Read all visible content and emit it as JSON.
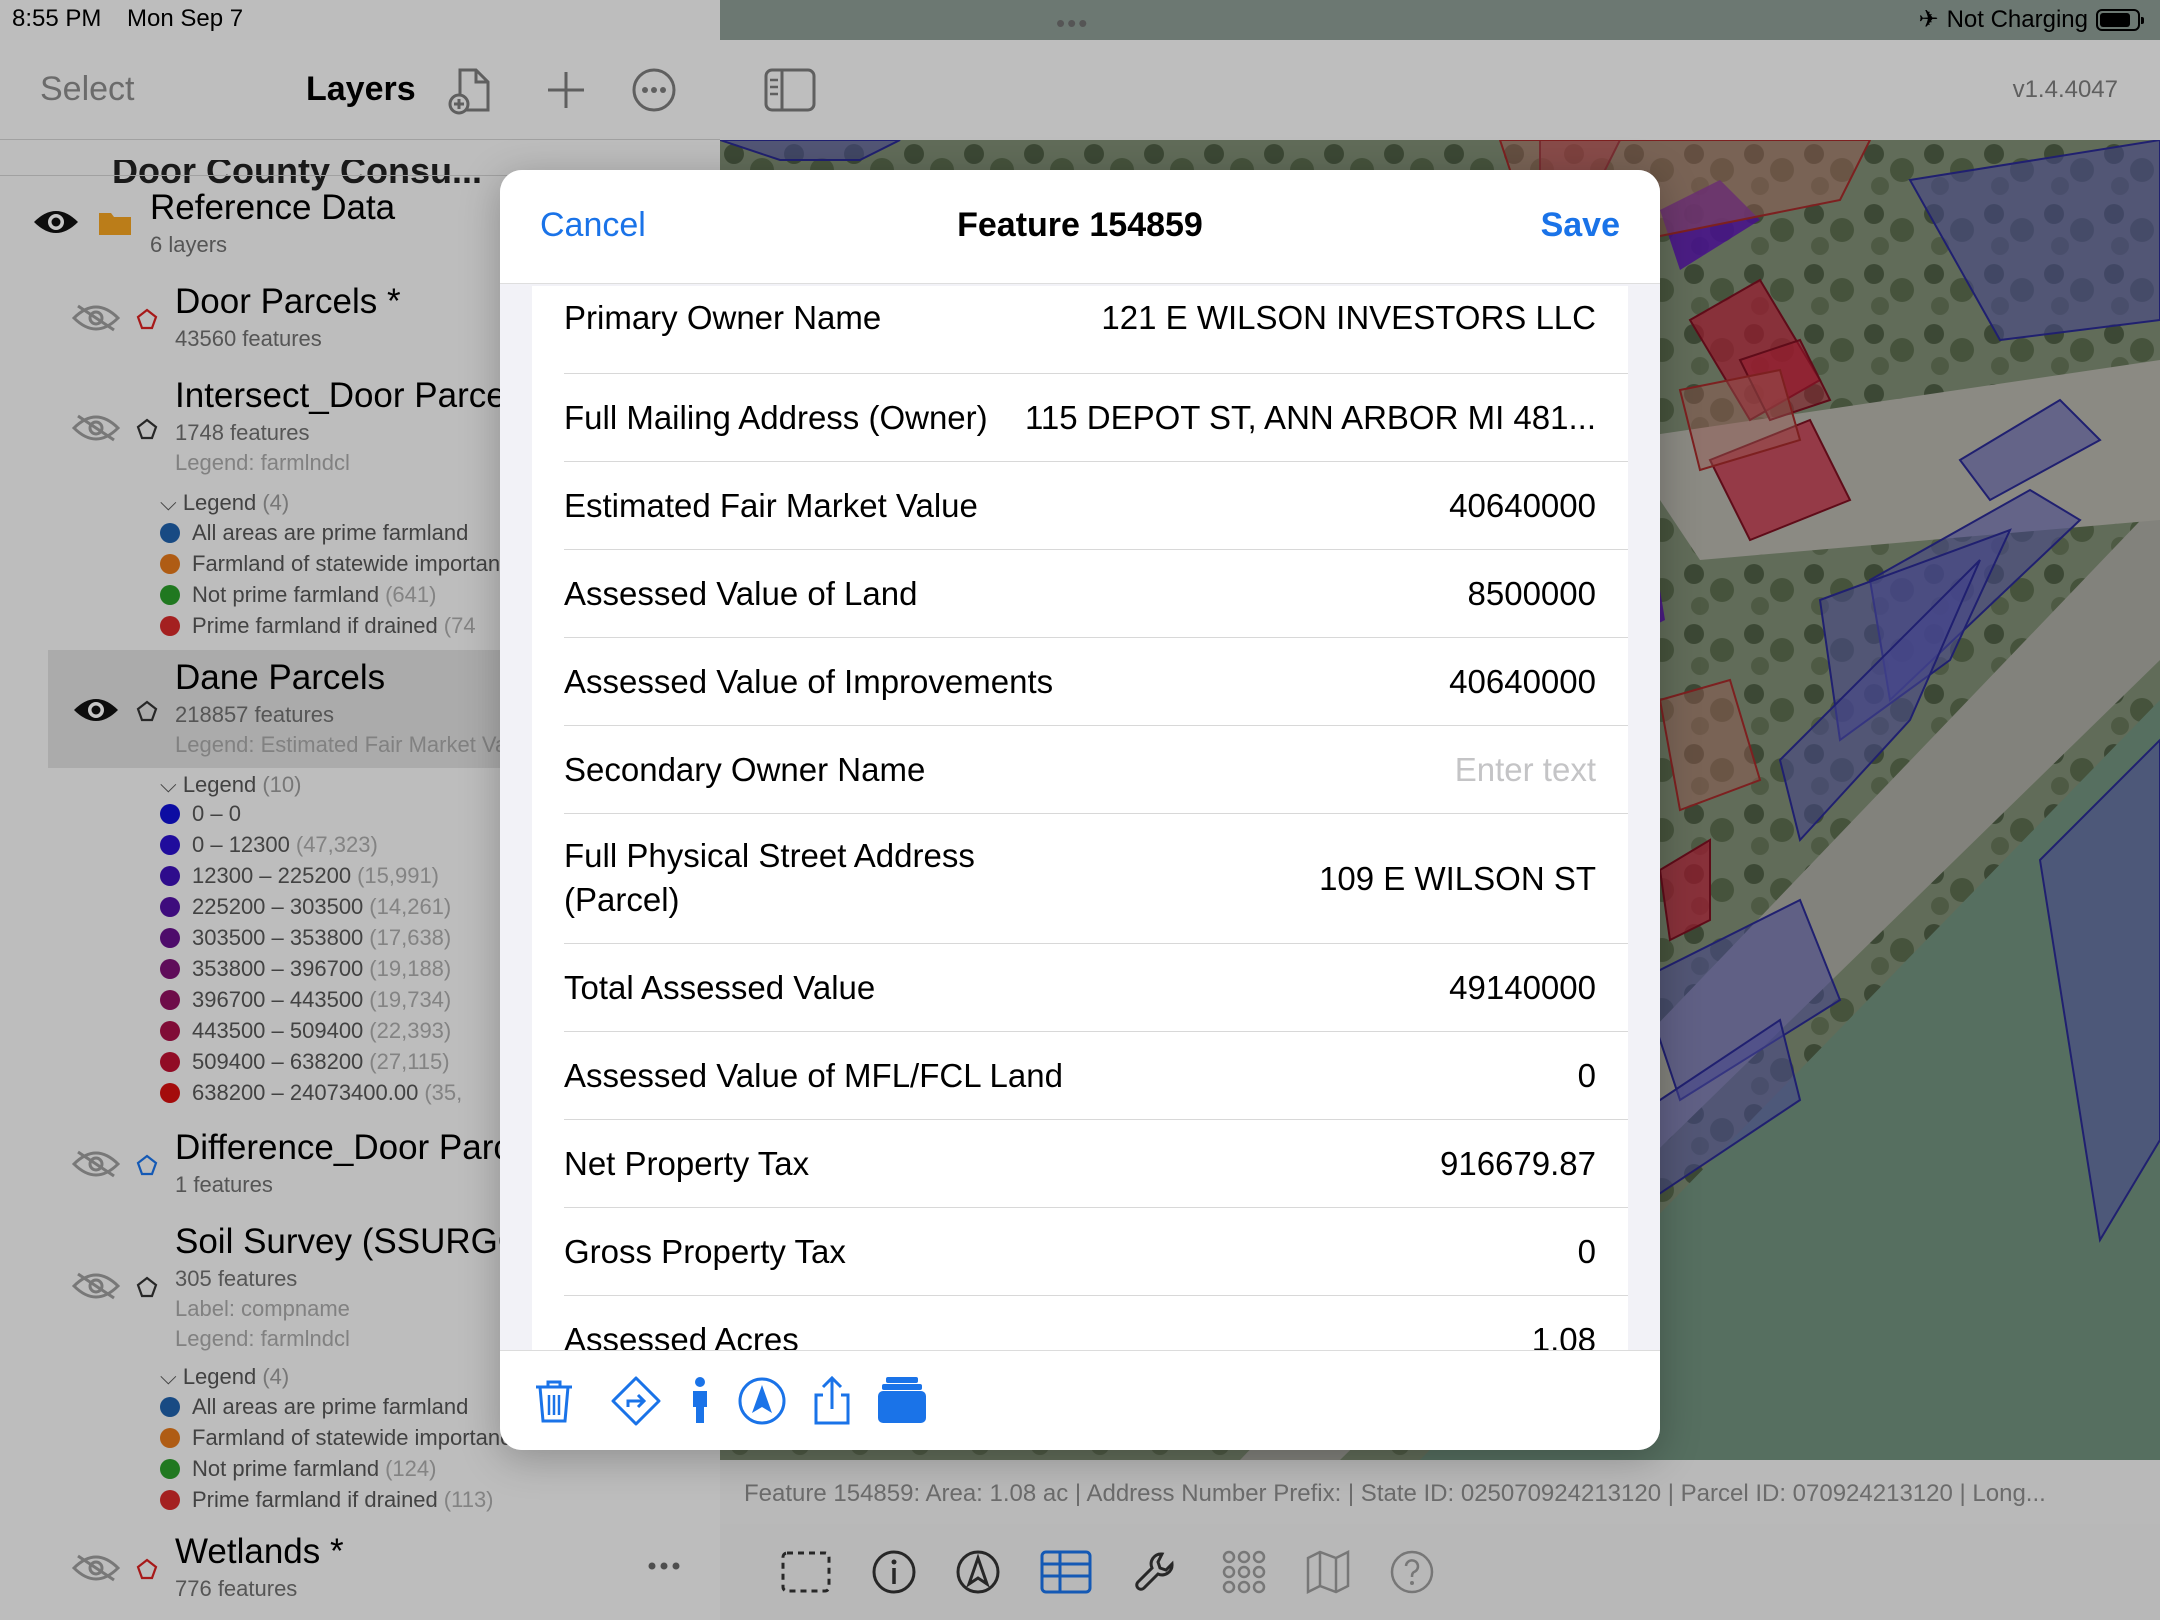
{
  "status_bar": {
    "time": "8:55 PM",
    "date": "Mon Sep 7",
    "charging": "Not Charging"
  },
  "sidebar": {
    "select_label": "Select",
    "title": "Layers",
    "cutoff_group": "Door County Consu...",
    "group": {
      "name": "Reference Data",
      "count": "6 layers"
    },
    "layers": [
      {
        "name": "Door Parcels *",
        "sub": "43560 features",
        "visible": false,
        "poly_color": "#d62020"
      },
      {
        "name": "Intersect_Door Parcels",
        "sub": "1748 features",
        "legend": "Legend: farmlndcl",
        "visible": false,
        "poly_color": "#333333"
      },
      {
        "name": "Dane Parcels",
        "sub": "218857 features",
        "legend": "Legend: Estimated Fair Market Value",
        "visible": true,
        "poly_color": "#333333"
      },
      {
        "name": "Difference_Door Parcels",
        "sub": "1 features",
        "visible": false,
        "poly_color": "#1a73e8"
      },
      {
        "name": "Soil Survey (SSURGO)",
        "sub": "305 features",
        "label": "Label: compname",
        "legend": "Legend: farmlndcl",
        "visible": false,
        "poly_color": "#333333"
      },
      {
        "name": "Wetlands *",
        "sub": "776 features",
        "visible": false,
        "poly_color": "#d62020"
      }
    ],
    "legend_intersect": {
      "header": "Legend",
      "count": "(4)",
      "items": [
        {
          "label": "All areas are prime farmland",
          "count": "",
          "color": "#1f5fa8"
        },
        {
          "label": "Farmland of statewide importance",
          "count": "",
          "color": "#e0771a"
        },
        {
          "label": "Not prime farmland",
          "count": "(641)",
          "color": "#2a9a2a"
        },
        {
          "label": "Prime farmland if drained",
          "count": "(74",
          "color": "#d22a2a"
        }
      ]
    },
    "legend_dane": {
      "header": "Legend",
      "count": "(10)",
      "items": [
        {
          "label": "0 – 0",
          "count": "",
          "color": "#1010d0"
        },
        {
          "label": "0 – 12300",
          "count": "(47,323)",
          "color": "#2a10c8"
        },
        {
          "label": "12300 – 225200",
          "count": "(15,991)",
          "color": "#3c10b4"
        },
        {
          "label": "225200 – 303500",
          "count": "(14,261)",
          "color": "#5010a0"
        },
        {
          "label": "303500 – 353800",
          "count": "(17,638)",
          "color": "#64108a"
        },
        {
          "label": "353800 – 396700",
          "count": "(19,188)",
          "color": "#7a1074"
        },
        {
          "label": "396700 – 443500",
          "count": "(19,734)",
          "color": "#8e105e"
        },
        {
          "label": "443500 – 509400",
          "count": "(22,393)",
          "color": "#a41046"
        },
        {
          "label": "509400 – 638200",
          "count": "(27,115)",
          "color": "#ba1030"
        },
        {
          "label": "638200 – 24073400.00",
          "count": "(35,",
          "color": "#d21010"
        }
      ]
    },
    "legend_soil": {
      "header": "Legend",
      "count": "(4)",
      "items": [
        {
          "label": "All areas are prime farmland",
          "count": "",
          "color": "#1f5fa8"
        },
        {
          "label": "Farmland of statewide importance",
          "count": "",
          "color": "#e0771a"
        },
        {
          "label": "Not prime farmland",
          "count": "(124)",
          "color": "#2a9a2a"
        },
        {
          "label": "Prime farmland if drained",
          "count": "(113)",
          "color": "#d22a2a"
        }
      ]
    }
  },
  "map": {
    "version": "v1.4.4047",
    "status_line": "Feature 154859: Area: 1.08 ac | Address Number Prefix:  | State ID: 025070924213120 | Parcel ID: 070924213120 | Long..."
  },
  "modal": {
    "cancel_label": "Cancel",
    "title": "Feature 154859",
    "save_label": "Save",
    "fields": [
      {
        "label": "Primary Owner Name",
        "value": "121 E WILSON INVESTORS LLC"
      },
      {
        "label": "Full Mailing Address (Owner)",
        "value": "115 DEPOT ST, ANN ARBOR MI  481..."
      },
      {
        "label": "Estimated Fair Market Value",
        "value": "40640000"
      },
      {
        "label": "Assessed Value of Land",
        "value": "8500000"
      },
      {
        "label": "Assessed Value of Improvements",
        "value": "40640000"
      },
      {
        "label": "Secondary Owner Name",
        "value": "",
        "placeholder": "Enter text"
      },
      {
        "label": "Full Physical Street Address (Parcel)",
        "value": "109 E WILSON ST"
      },
      {
        "label": "Total Assessed Value",
        "value": "49140000"
      },
      {
        "label": "Assessed Value of MFL/FCL Land",
        "value": "0"
      },
      {
        "label": "Net Property Tax",
        "value": "916679.87"
      },
      {
        "label": "Gross Property Tax",
        "value": "0"
      },
      {
        "label": "Assessed Acres",
        "value": "1.08"
      }
    ],
    "footer_icons": [
      "trash-icon",
      "directions-icon",
      "person-icon",
      "navigate-icon",
      "share-icon",
      "layers-stack-icon"
    ]
  },
  "colors": {
    "accent": "#1a73e8",
    "parcel_blue": "#5a5ab4",
    "parcel_red": "#c4203a",
    "parcel_purple": "#5a14b4"
  }
}
